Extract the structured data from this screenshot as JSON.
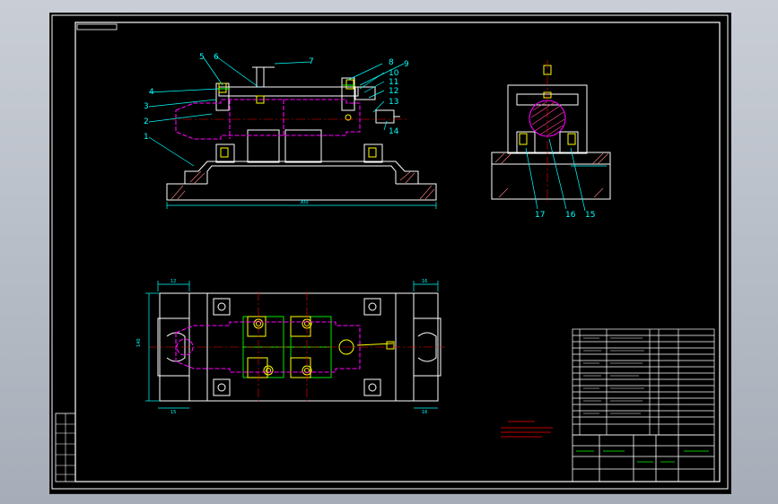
{
  "callouts": [
    "1",
    "2",
    "3",
    "4",
    "5",
    "6",
    "7",
    "8",
    "9",
    "10",
    "11",
    "12",
    "13",
    "14",
    "15",
    "16",
    "17"
  ],
  "dims": {
    "overall_length": "300",
    "overall_width": "140",
    "bolt_hole_a": "12",
    "bolt_hole_b": "16",
    "bolt_hole_c": "15",
    "bolt_hole_d": "16"
  },
  "colors": {
    "background": "#000000",
    "border": "#ffffff",
    "part": "#ffffff",
    "workpiece": "#ff00ff",
    "dimension": "#00ffff",
    "section_hatch": "#ff8080",
    "clamp_plate": "#00ff00",
    "bolts": "#ffff00",
    "leader": "#ff0000",
    "notes": "#ff0000"
  }
}
